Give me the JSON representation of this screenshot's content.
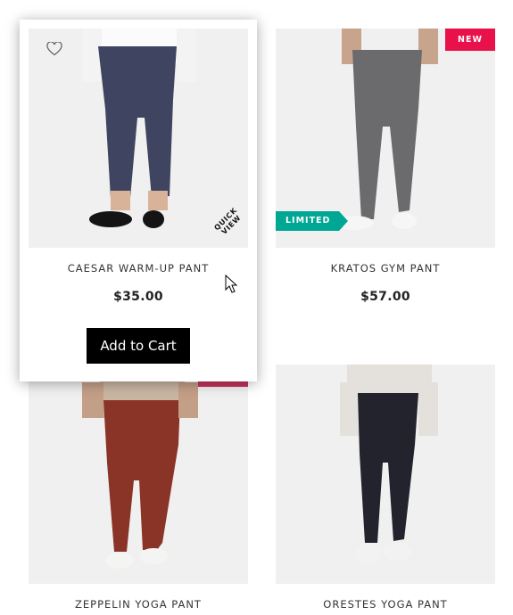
{
  "colors": {
    "new_badge": "#e8114a",
    "limited_badge": "#00a794",
    "button_bg": "#000000",
    "ghost_badge": "#c4345c"
  },
  "products": [
    {
      "name": "CAESAR WARM-UP PANT",
      "price": "$35.00",
      "add_to_cart": "Add to Cart",
      "quick_view_line1": "QUICK",
      "quick_view_line2": "VIEW",
      "icon": "heart-icon"
    },
    {
      "name": "KRATOS GYM PANT",
      "price": "$57.00",
      "badges": [
        "NEW",
        "LIMITED"
      ]
    },
    {
      "name": "ZEPPELIN YOGA PANT"
    },
    {
      "name": "ORESTES YOGA PANT"
    }
  ]
}
